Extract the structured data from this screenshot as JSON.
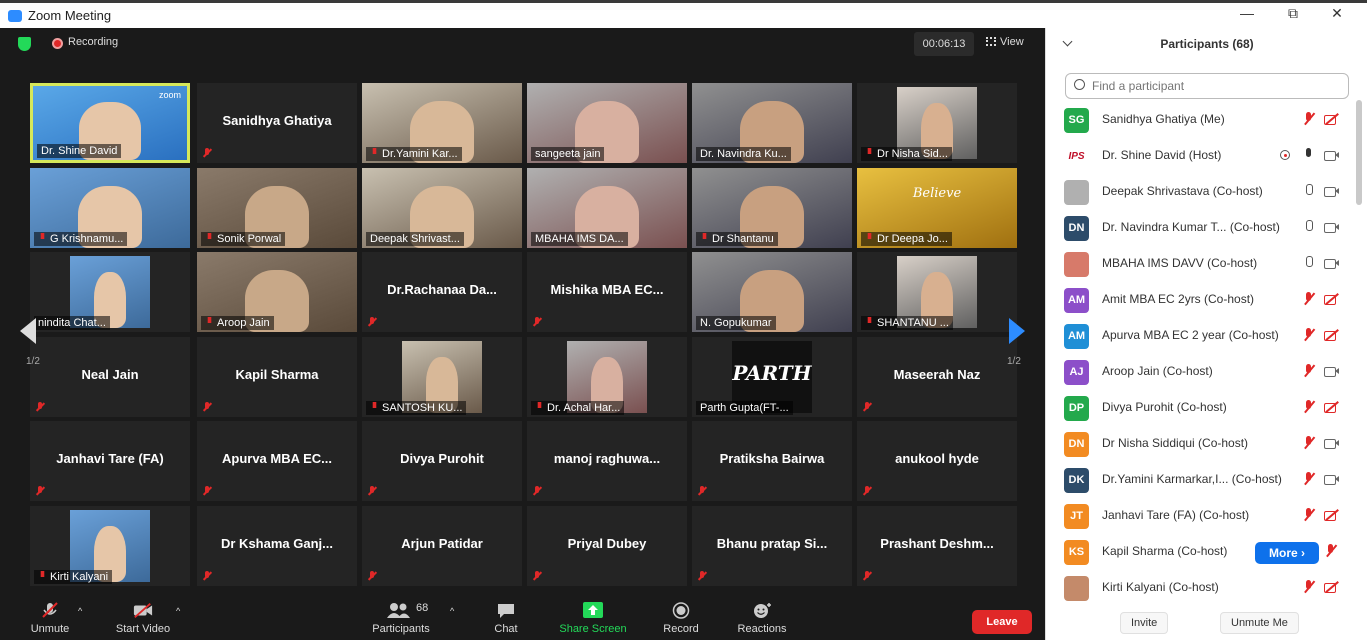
{
  "window": {
    "title": "Zoom Meeting",
    "minimize": "—",
    "maximize": "⧉",
    "close": "✕"
  },
  "meeting": {
    "recording_label": "Recording",
    "timer": "00:06:13",
    "view_label": "View",
    "page_left": "1/2",
    "page_right": "1/2"
  },
  "tiles": [
    {
      "name": "Dr. Shine David",
      "mode": "video",
      "muted": false,
      "active": true,
      "watermark": "zoom"
    },
    {
      "name": "Sanidhya Ghatiya",
      "mode": "name",
      "muted": true
    },
    {
      "name": "Dr.Yamini Kar...",
      "mode": "video",
      "muted": true
    },
    {
      "name": "sangeeta jain",
      "mode": "video",
      "muted": false
    },
    {
      "name": "Dr. Navindra Ku...",
      "mode": "video",
      "muted": false
    },
    {
      "name": "Dr Nisha Sid...",
      "mode": "video",
      "muted": true
    },
    {
      "name": "G Krishnamu...",
      "mode": "video",
      "muted": true
    },
    {
      "name": "Sonik Porwal",
      "mode": "video",
      "muted": true
    },
    {
      "name": "Deepak Shrivast...",
      "mode": "video",
      "muted": false
    },
    {
      "name": "MBAHA IMS DA...",
      "mode": "video",
      "muted": false
    },
    {
      "name": "Dr Shantanu",
      "mode": "video",
      "muted": true
    },
    {
      "name": "Dr Deepa Jo...",
      "mode": "video",
      "muted": true,
      "believe": "Believe"
    },
    {
      "name": "nindita Chat...",
      "mode": "video",
      "muted": false
    },
    {
      "name": "Aroop Jain",
      "mode": "video",
      "muted": true
    },
    {
      "name": "Dr.Rachanaa Da...",
      "mode": "name",
      "muted": true
    },
    {
      "name": "Mishika MBA EC...",
      "mode": "name",
      "muted": true
    },
    {
      "name": "N. Gopukumar",
      "mode": "video",
      "muted": false
    },
    {
      "name": "SHANTANU ...",
      "mode": "video",
      "muted": true
    },
    {
      "name": "Neal Jain",
      "mode": "name",
      "muted": true
    },
    {
      "name": "Kapil Sharma",
      "mode": "name",
      "muted": true
    },
    {
      "name": "SANTOSH KU...",
      "mode": "video",
      "muted": true
    },
    {
      "name": "Dr. Achal Har...",
      "mode": "video",
      "muted": true
    },
    {
      "name": "Parth Gupta(FT-...",
      "mode": "video",
      "muted": false,
      "logo": "PARTH"
    },
    {
      "name": "Maseerah Naz",
      "mode": "name",
      "muted": true
    },
    {
      "name": "Janhavi Tare (FA)",
      "mode": "name",
      "muted": true
    },
    {
      "name": "Apurva MBA EC...",
      "mode": "name",
      "muted": true
    },
    {
      "name": "Divya Purohit",
      "mode": "name",
      "muted": true
    },
    {
      "name": "manoj raghuwa...",
      "mode": "name",
      "muted": true
    },
    {
      "name": "Pratiksha Bairwa",
      "mode": "name",
      "muted": true
    },
    {
      "name": "anukool hyde",
      "mode": "name",
      "muted": true
    },
    {
      "name": "Kirti Kalyani",
      "mode": "video",
      "muted": true
    },
    {
      "name": "Dr Kshama Ganj...",
      "mode": "name",
      "muted": true
    },
    {
      "name": "Arjun Patidar",
      "mode": "name",
      "muted": true
    },
    {
      "name": "Priyal Dubey",
      "mode": "name",
      "muted": true
    },
    {
      "name": "Bhanu pratap Si...",
      "mode": "name",
      "muted": true
    },
    {
      "name": "Prashant Deshm...",
      "mode": "name",
      "muted": true
    }
  ],
  "toolbar": {
    "unmute": "Unmute",
    "start_video": "Start Video",
    "participants": "Participants",
    "participants_count": "68",
    "chat": "Chat",
    "share_screen": "Share Screen",
    "record": "Record",
    "reactions": "Reactions",
    "leave": "Leave"
  },
  "panel": {
    "title": "Participants (68)",
    "search_placeholder": "Find a participant",
    "more": "More ›",
    "invite": "Invite",
    "unmute_me": "Unmute Me",
    "participants": [
      {
        "initials": "SG",
        "color": "#23a94c",
        "name": "Sanidhya Ghatiya (Me)",
        "mic": "off",
        "cam": "off"
      },
      {
        "initials": "IPS",
        "color": "#ffffff",
        "name": "Dr. Shine David (Host)",
        "mic": "on-dark",
        "cam": "on",
        "share": true
      },
      {
        "initials": "",
        "color": "#b0b0b0",
        "name": "Deepak Shrivastava (Co-host)",
        "mic": "on",
        "cam": "on"
      },
      {
        "initials": "DN",
        "color": "#2d4c6a",
        "name": "Dr. Navindra Kumar T... (Co-host)",
        "mic": "on",
        "cam": "on"
      },
      {
        "initials": "",
        "color": "#d77a6a",
        "name": "MBAHA IMS DAVV (Co-host)",
        "mic": "on",
        "cam": "on"
      },
      {
        "initials": "AM",
        "color": "#8c4fc9",
        "name": "Amit MBA EC 2yrs (Co-host)",
        "mic": "off",
        "cam": "off"
      },
      {
        "initials": "AM",
        "color": "#1f8fd6",
        "name": "Apurva MBA EC 2 year (Co-host)",
        "mic": "off",
        "cam": "off"
      },
      {
        "initials": "AJ",
        "color": "#8c4fc9",
        "name": "Aroop Jain (Co-host)",
        "mic": "off",
        "cam": "on"
      },
      {
        "initials": "DP",
        "color": "#23a94c",
        "name": "Divya Purohit (Co-host)",
        "mic": "off",
        "cam": "off"
      },
      {
        "initials": "DN",
        "color": "#f28b22",
        "name": "Dr Nisha Siddiqui (Co-host)",
        "mic": "off",
        "cam": "on"
      },
      {
        "initials": "DK",
        "color": "#2d4c6a",
        "name": "Dr.Yamini Karmarkar,I... (Co-host)",
        "mic": "off",
        "cam": "on"
      },
      {
        "initials": "JT",
        "color": "#f28b22",
        "name": "Janhavi Tare (FA) (Co-host)",
        "mic": "off",
        "cam": "off"
      },
      {
        "initials": "KS",
        "color": "#f28b22",
        "name": "Kapil Sharma (Co-host)",
        "mic": "off",
        "cam": "none"
      },
      {
        "initials": "",
        "color": "#c48a6a",
        "name": "Kirti Kalyani (Co-host)",
        "mic": "off",
        "cam": "off"
      }
    ]
  }
}
